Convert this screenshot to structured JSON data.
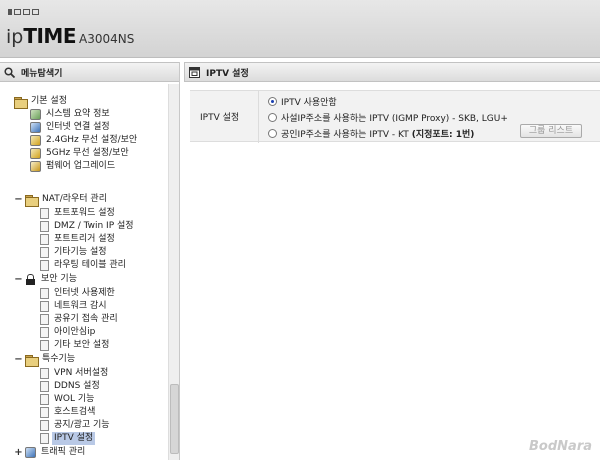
{
  "header": {
    "brand_ip": "ip",
    "brand_time": "TIME",
    "model": "A3004NS"
  },
  "nav_panel": {
    "title": "메뉴탐색기"
  },
  "tree": {
    "basic": {
      "label": "기본 설정",
      "items": [
        "시스템 요약 정보",
        "인터넷 연결 설정",
        "2.4GHz 무선 설정/보안",
        "5GHz 무선 설정/보안",
        "펌웨어 업그레이드"
      ]
    },
    "nat": {
      "label": "NAT/라우터 관리",
      "items": [
        "포트포워드 설정",
        "DMZ / Twin IP 설정",
        "포트트리거 설정",
        "기타기능 설정",
        "라우팅 테이블 관리"
      ]
    },
    "security": {
      "label": "보안 기능",
      "items": [
        "인터넷 사용제한",
        "네트워크 감시",
        "공유기 접속 관리",
        "아이안심ip",
        "기타 보안 설정"
      ]
    },
    "special": {
      "label": "특수기능",
      "items": [
        "VPN 서버설정",
        "DDNS 설정",
        "WOL 기능",
        "호스트검색",
        "공지/광고 기능",
        "IPTV 설정"
      ],
      "selected_index": 5
    },
    "traffic": {
      "label": "트래픽 관리"
    }
  },
  "content": {
    "title": "IPTV 설정",
    "row_label": "IPTV 설정",
    "options": [
      {
        "label": "IPTV 사용안함",
        "selected": true
      },
      {
        "label": "사설IP주소를 사용하는 IPTV (IGMP Proxy) - SKB, LGU+",
        "selected": false
      },
      {
        "label": "공인IP주소를 사용하는 IPTV - KT",
        "label_bold": "(지정포트: 1번)",
        "selected": false
      }
    ],
    "group_list_button": "그룹 리스트"
  },
  "watermark": "BodNara"
}
